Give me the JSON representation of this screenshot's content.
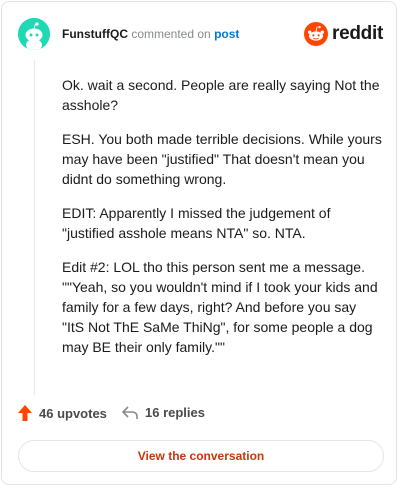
{
  "header": {
    "username": "FunstuffQC",
    "action_text": "commented on",
    "link_text": "post",
    "brand": "reddit"
  },
  "comment": {
    "paragraphs": [
      "Ok. wait a second. People are really saying Not the asshole?",
      "ESH. You both made terrible decisions. While yours may have been \"justified\" That doesn't mean you didnt do something wrong.",
      "EDIT: Apparently I missed the judgement of \"justified asshole means NTA\" so. NTA.",
      "Edit #2: LOL tho this person sent me a message. \"\"Yeah, so you wouldn't mind if I took your kids and family for a few days, right? And before you say \"ItS Not ThE SaMe ThiNg\", for some people a dog may BE their only family.\"\""
    ]
  },
  "footer": {
    "upvotes": "46 upvotes",
    "replies": "16 replies",
    "cta": "View the conversation"
  },
  "colors": {
    "accent": "#ff4500",
    "avatar_bg": "#1ed9b3",
    "link": "#0079d3"
  },
  "icons": [
    "snoo-avatar-icon",
    "reddit-logo-icon",
    "upvote-arrow-icon",
    "reply-arrow-icon"
  ]
}
